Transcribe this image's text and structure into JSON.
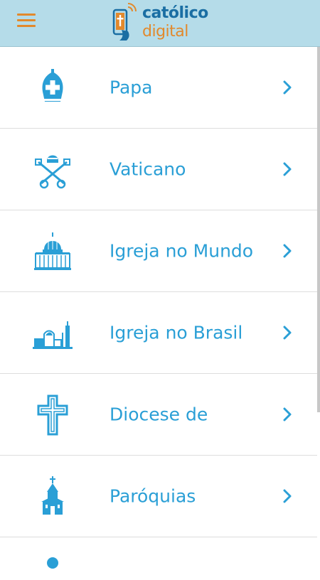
{
  "header": {
    "logo_line1": "católico",
    "logo_line2": "digital",
    "brand_blue": "#1a6ea3",
    "brand_orange": "#e2892c",
    "header_bg": "#b5dce9"
  },
  "menu": {
    "accent": "#2a9fd6",
    "items": [
      {
        "label": "Papa",
        "icon": "mitre-icon"
      },
      {
        "label": "Vaticano",
        "icon": "papal-keys-icon"
      },
      {
        "label": "Igreja no Mundo",
        "icon": "basilica-icon"
      },
      {
        "label": "Igreja no Brasil",
        "icon": "cathedral-skyline-icon"
      },
      {
        "label": "Diocese de",
        "icon": "cross-icon"
      },
      {
        "label": "Paróquias",
        "icon": "chapel-icon"
      }
    ]
  }
}
